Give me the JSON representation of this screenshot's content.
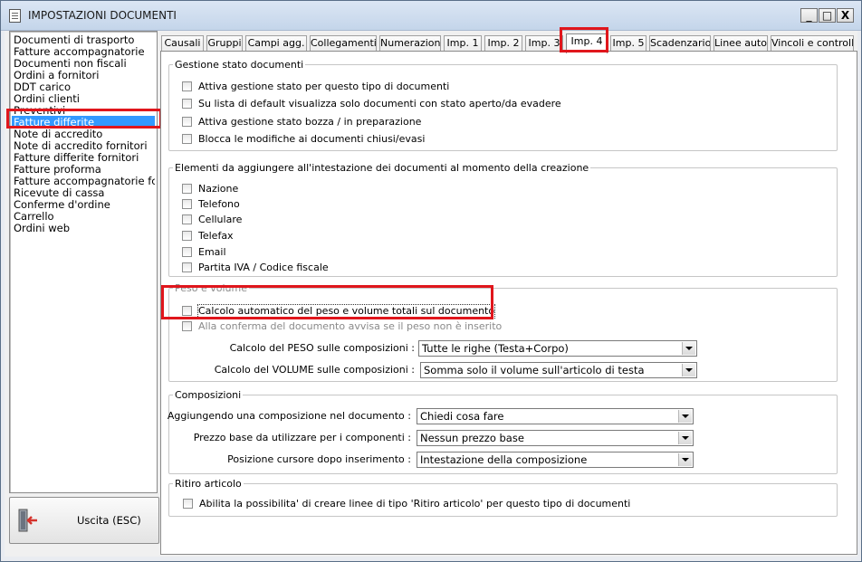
{
  "window": {
    "title": "IMPOSTAZIONI DOCUMENTI",
    "minimize": "_",
    "maximize": "□",
    "close": "X"
  },
  "doc_list": [
    "Documenti di trasporto",
    "Fatture accompagnatorie",
    "Documenti non fiscali",
    "Ordini a fornitori",
    "DDT carico",
    "Ordini clienti",
    "Preventivi",
    "Fatture differite",
    "Note di accredito",
    "Note di accredito fornitori",
    "Fatture differite fornitori",
    "Fatture proforma",
    "Fatture accompagnatorie fc",
    "Ricevute di cassa",
    "Conferme d'ordine",
    "Carrello",
    "Ordini web"
  ],
  "selected_doc": "Fatture differite",
  "exit_button": "Uscita (ESC)",
  "tabs": [
    "Causali",
    "Gruppi",
    "Campi agg.",
    "Collegamenti",
    "Numerazioni",
    "Imp. 1",
    "Imp. 2",
    "Imp. 3",
    "Imp. 4",
    "Imp. 5",
    "Scadenzario",
    "Linee auto",
    "Vincoli e controlli"
  ],
  "active_tab": "Imp. 4",
  "gestione": {
    "legend": "Gestione stato documenti",
    "options": [
      "Attiva gestione stato per questo tipo di documenti",
      "Su lista di default visualizza solo documenti con stato aperto/da evadere",
      "Attiva gestione stato bozza / in preparazione",
      "Blocca le modifiche ai documenti chiusi/evasi"
    ]
  },
  "intestazione": {
    "legend": "Elementi da aggiungere all'intestazione dei documenti al momento della creazione",
    "options": [
      "Nazione",
      "Telefono",
      "Cellulare",
      "Telefax",
      "Email",
      "Partita IVA / Codice fiscale"
    ]
  },
  "peso": {
    "legend": "Peso e volume",
    "options": [
      "Calcolo automatico del peso e volume totali sul documento",
      "Alla conferma del documento avvisa se il peso non è inserito"
    ],
    "peso_label": "Calcolo del PESO sulle composizioni :",
    "peso_value": "Tutte le righe (Testa+Corpo)",
    "volume_label": "Calcolo del VOLUME sulle composizioni :",
    "volume_value": "Somma solo il volume sull'articolo di testa"
  },
  "composizioni": {
    "legend": "Composizioni",
    "rows": [
      {
        "label": "Aggiungendo una composizione nel documento :",
        "value": "Chiedi cosa fare"
      },
      {
        "label": "Prezzo base da utilizzare per i componenti :",
        "value": "Nessun prezzo base"
      },
      {
        "label": "Posizione cursore dopo inserimento :",
        "value": "Intestazione della composizione"
      }
    ]
  },
  "ritiro": {
    "legend": "Ritiro articolo",
    "option": "Abilita la possibilita' di creare linee di tipo 'Ritiro articolo' per questo tipo di documenti"
  },
  "colors": {
    "highlight": "#e0161c",
    "selection": "#3399ff"
  }
}
